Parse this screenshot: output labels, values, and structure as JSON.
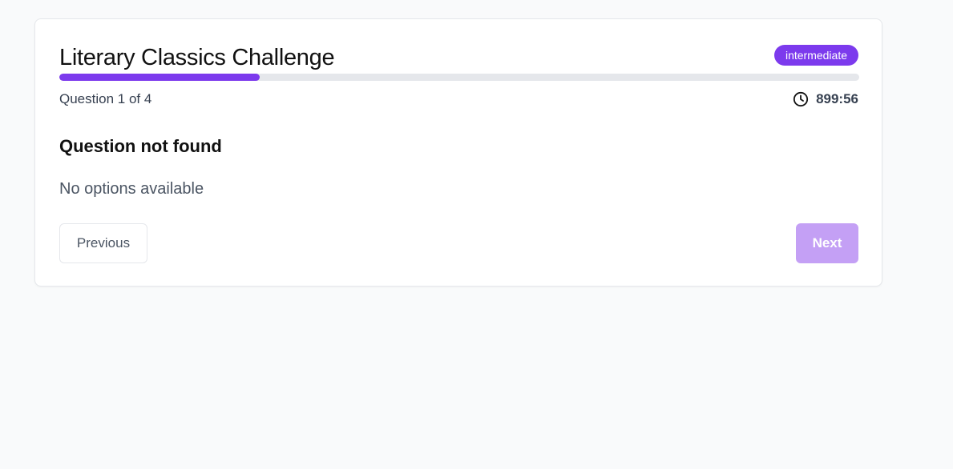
{
  "quiz": {
    "title": "Literary Classics Challenge",
    "difficulty": "intermediate",
    "progress_fraction": 0.25,
    "counter_text": "Question 1 of 4",
    "timer": "899:56",
    "timer_icon": "clock-icon"
  },
  "question": {
    "text": "Question not found",
    "options_message": "No options available"
  },
  "navigation": {
    "previous_label": "Previous",
    "next_label": "Next"
  },
  "colors": {
    "accent": "#7c3aed",
    "accent_disabled": "#c4a0f5",
    "progress_track": "#e5e7eb",
    "page_background": "#f9fafb"
  }
}
